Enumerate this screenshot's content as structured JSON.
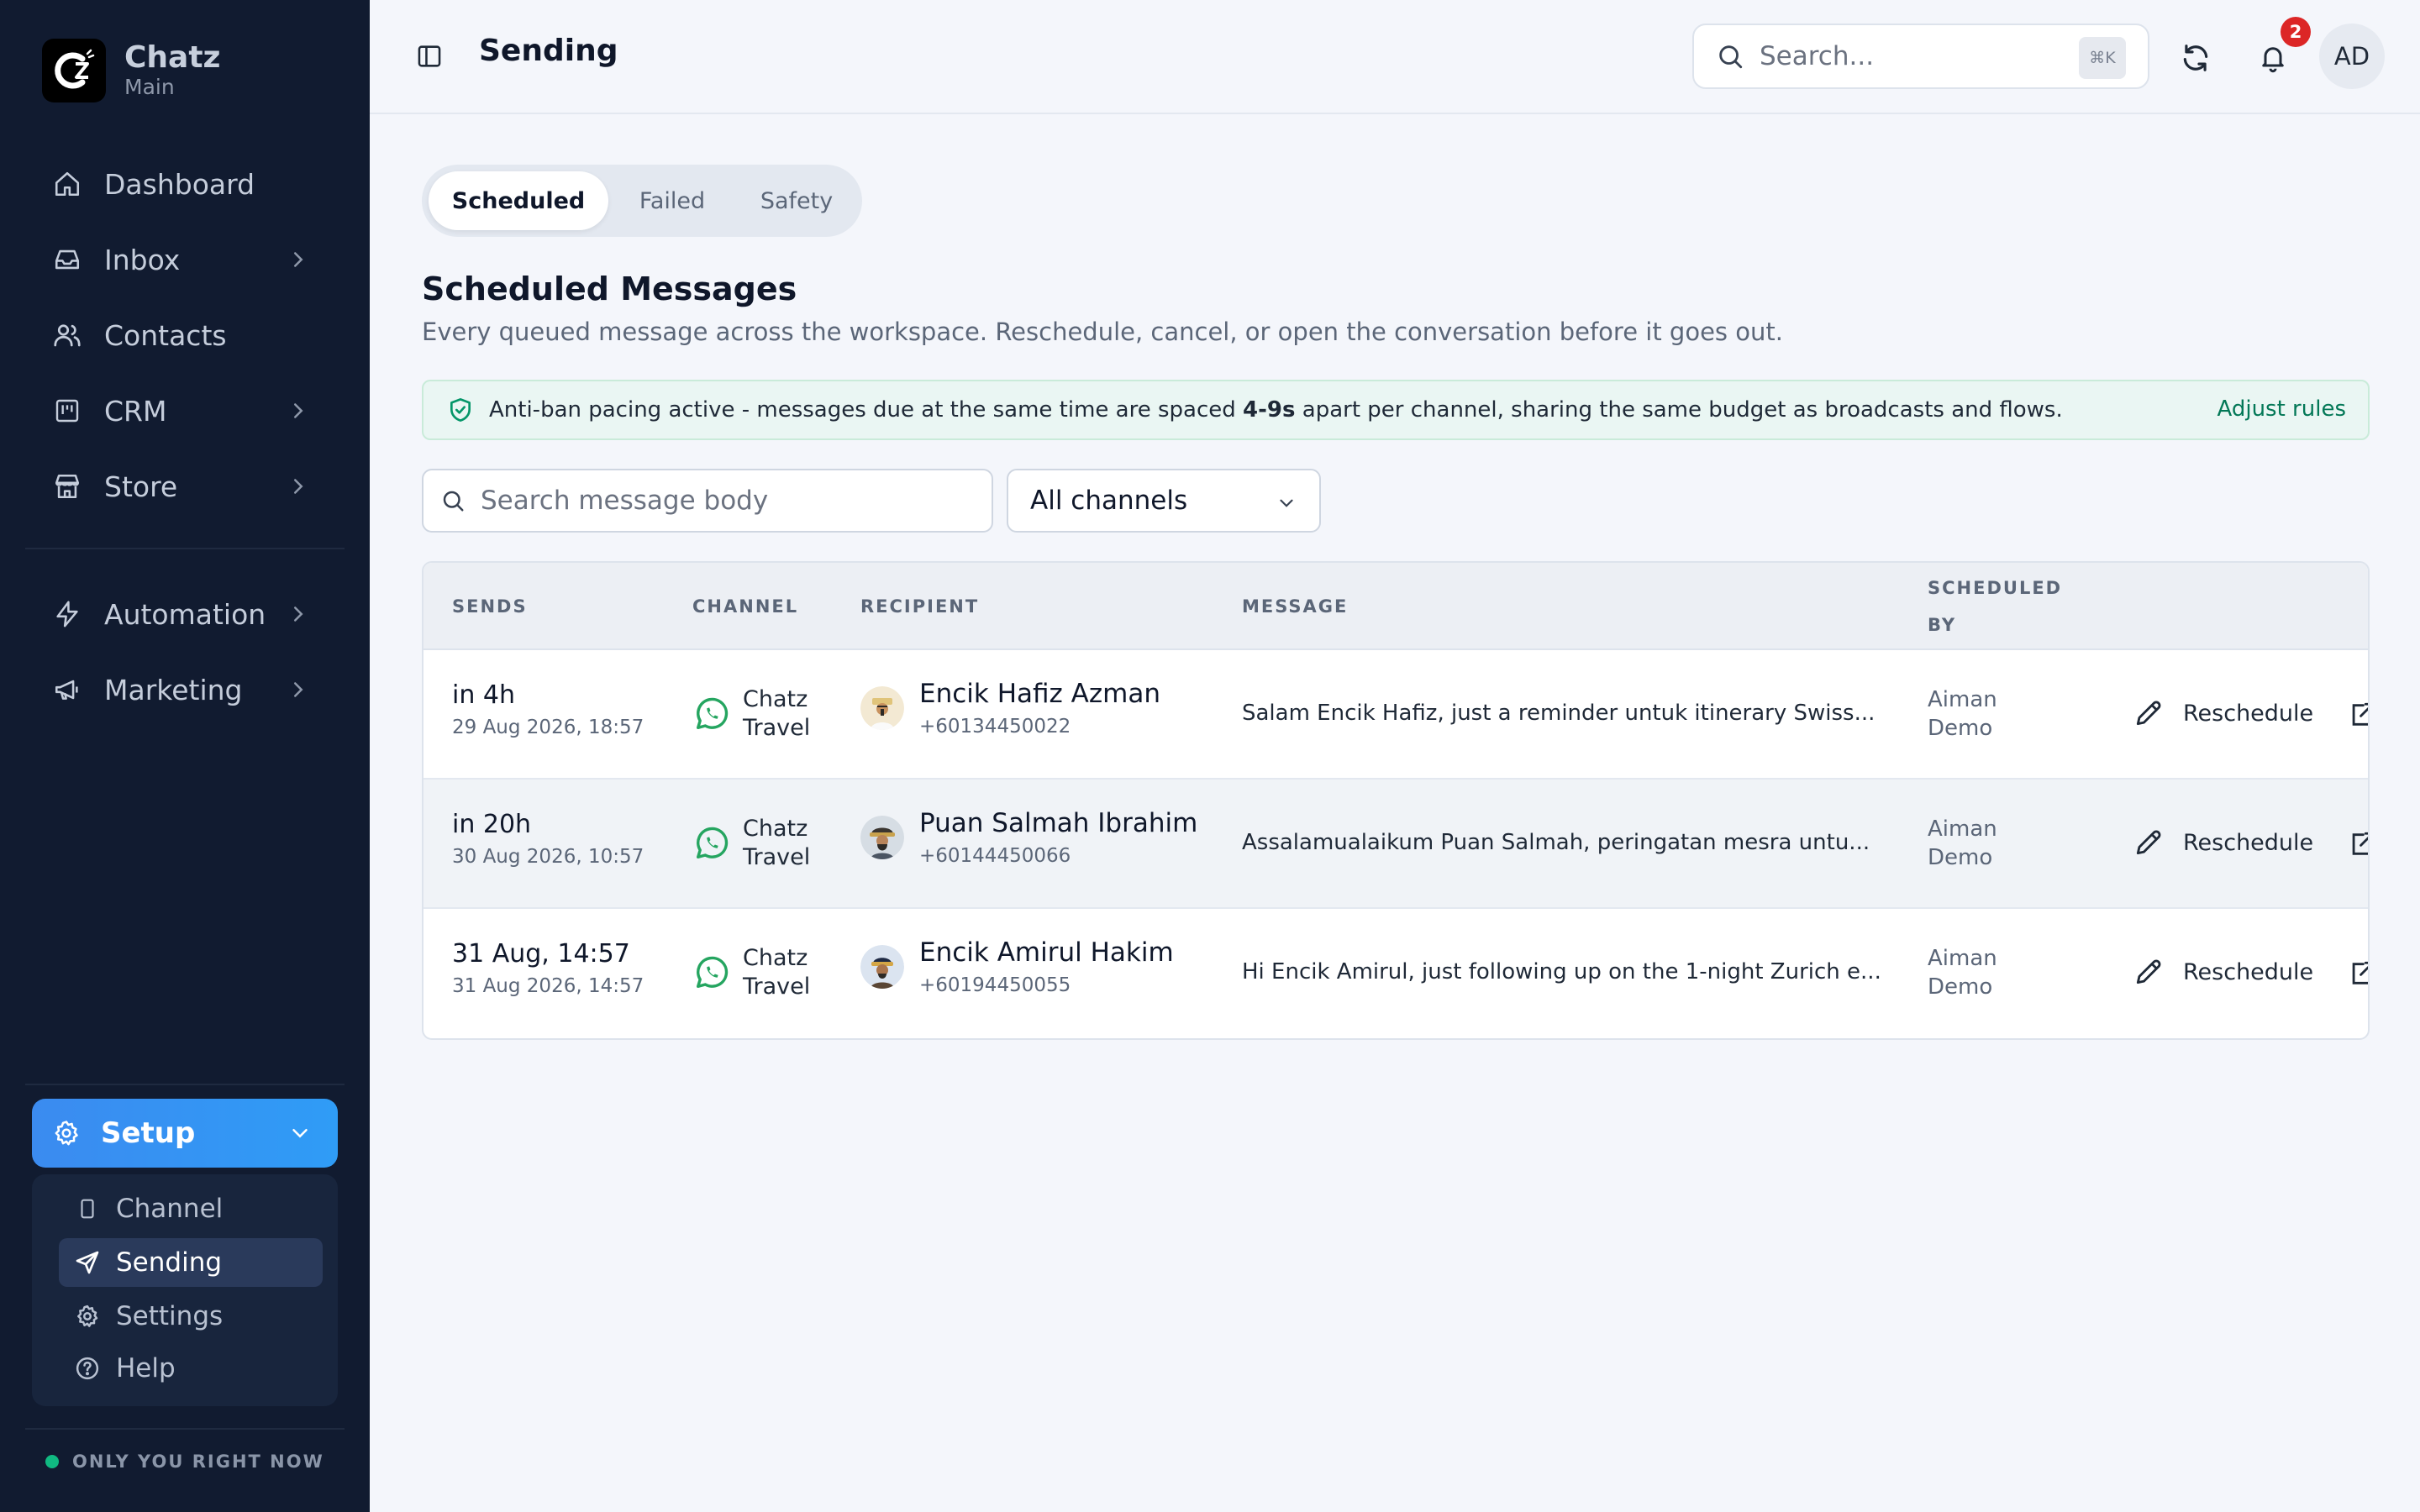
{
  "app": {
    "name": "Chatz",
    "workspace": "Main"
  },
  "sidebar": {
    "items": [
      {
        "label": "Dashboard"
      },
      {
        "label": "Inbox"
      },
      {
        "label": "Contacts"
      },
      {
        "label": "CRM"
      },
      {
        "label": "Store"
      },
      {
        "label": "Automation"
      },
      {
        "label": "Marketing"
      }
    ],
    "setup": {
      "label": "Setup",
      "children": [
        {
          "label": "Channel"
        },
        {
          "label": "Sending"
        },
        {
          "label": "Settings"
        },
        {
          "label": "Help"
        }
      ]
    },
    "presence": "ONLY YOU RIGHT NOW"
  },
  "header": {
    "title": "Sending",
    "search_placeholder": "Search...",
    "search_shortcut": "⌘K",
    "notification_count": "2",
    "user_initials": "AD"
  },
  "tabs": [
    {
      "label": "Scheduled",
      "active": true
    },
    {
      "label": "Failed",
      "active": false
    },
    {
      "label": "Safety",
      "active": false
    }
  ],
  "section": {
    "title": "Scheduled Messages",
    "subtitle": "Every queued message across the workspace. Reschedule, cancel, or open the conversation before it goes out."
  },
  "notice": {
    "text_before": "Anti-ban pacing active - messages due at the same time are spaced ",
    "text_bold": "4-9s",
    "text_after": " apart per channel, sharing the same budget as broadcasts and flows.",
    "action": "Adjust rules"
  },
  "filters": {
    "search_placeholder": "Search message body",
    "channel_selected": "All channels"
  },
  "table": {
    "columns": {
      "sends": "SENDS",
      "channel": "CHANNEL",
      "recipient": "RECIPIENT",
      "message": "MESSAGE",
      "scheduled_by_1": "SCHEDULED",
      "scheduled_by_2": "BY"
    },
    "reschedule_label": "Reschedule",
    "rows": [
      {
        "sends": "in 4h",
        "sends_date": "29 Aug 2026, 18:57",
        "channel_1": "Chatz",
        "channel_2": "Travel",
        "name": "Encik Hafiz Azman",
        "phone": "+60134450022",
        "message": "Salam Encik Hafiz, just a reminder untuk itinerary Swiss...",
        "by_1": "Aiman",
        "by_2": "Demo"
      },
      {
        "sends": "in 20h",
        "sends_date": "30 Aug 2026, 10:57",
        "channel_1": "Chatz",
        "channel_2": "Travel",
        "name": "Puan Salmah Ibrahim",
        "phone": "+60144450066",
        "message": "Assalamualaikum Puan Salmah, peringatan mesra untu...",
        "by_1": "Aiman",
        "by_2": "Demo"
      },
      {
        "sends": "31 Aug, 14:57",
        "sends_date": "31 Aug 2026, 14:57",
        "channel_1": "Chatz",
        "channel_2": "Travel",
        "name": "Encik Amirul Hakim",
        "phone": "+60194450055",
        "message": "Hi Encik Amirul, just following up on the 1-night Zurich e...",
        "by_1": "Aiman",
        "by_2": "Demo"
      }
    ]
  },
  "colors": {
    "sidebar_bg": "#111b30",
    "accent": "#3b8bf0",
    "whatsapp_green": "#25a560",
    "badge_red": "#dc2626",
    "notice_link": "#047857"
  }
}
